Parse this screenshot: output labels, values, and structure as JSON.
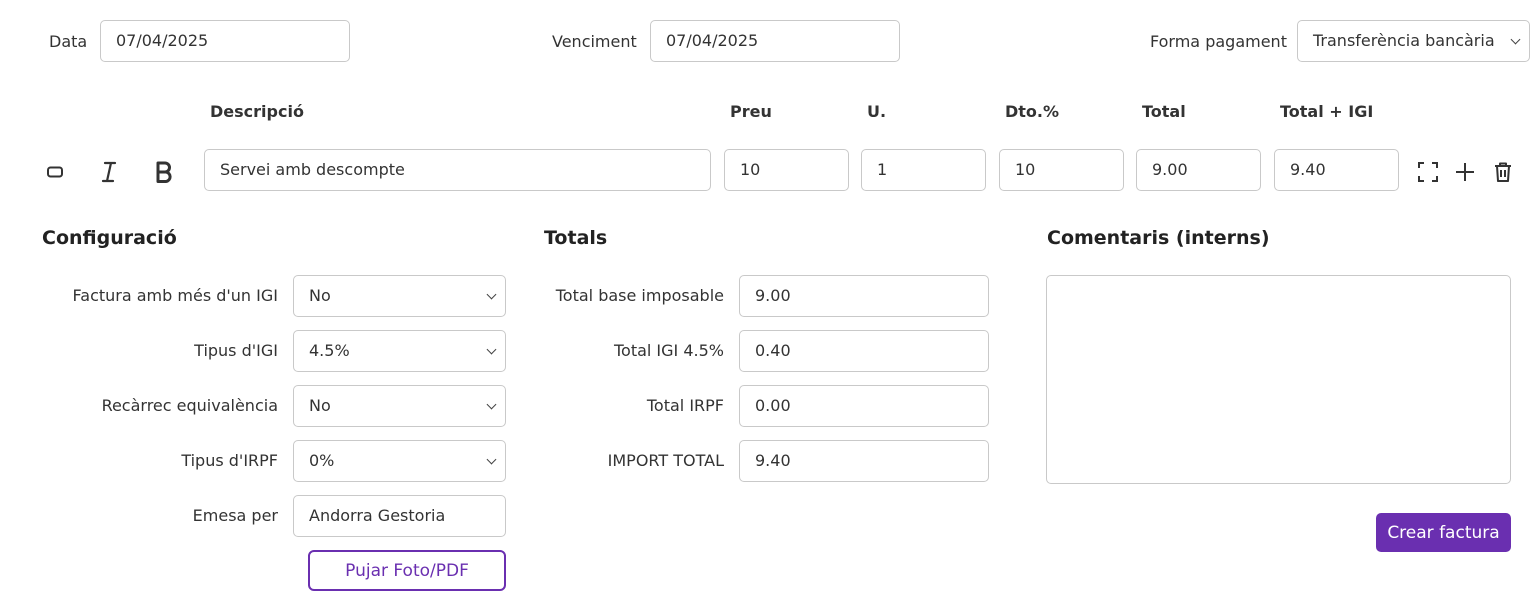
{
  "header": {
    "date_label": "Data",
    "date_value": "07/04/2025",
    "due_label": "Venciment",
    "due_value": "07/04/2025",
    "payment_label": "Forma pagament",
    "payment_value": "Transferència bancària"
  },
  "line_headers": {
    "description": "Descripció",
    "price": "Preu",
    "units": "U.",
    "discount": "Dto.%",
    "total": "Total",
    "total_igi": "Total + IGI"
  },
  "line_item": {
    "description": "Servei amb descompte",
    "price": "10",
    "units": "1",
    "discount": "10",
    "total": "9.00",
    "total_igi": "9.40"
  },
  "toolbar_icons": [
    "rectangle-icon",
    "italic-icon",
    "bold-icon",
    "expand-icon",
    "plus-icon",
    "trash-icon"
  ],
  "configuration": {
    "title": "Configuració",
    "multi_igi_label": "Factura amb més d'un IGI",
    "multi_igi_value": "No",
    "igi_type_label": "Tipus d'IGI",
    "igi_type_value": "4.5%",
    "surcharge_label": "Recàrrec equivalència",
    "surcharge_value": "No",
    "irpf_type_label": "Tipus d'IRPF",
    "irpf_type_value": "0%",
    "issued_by_label": "Emesa per",
    "issued_by_value": "Andorra Gestoria",
    "upload_button": "Pujar Foto/PDF"
  },
  "totals": {
    "title": "Totals",
    "base_label": "Total base imposable",
    "base_value": "9.00",
    "igi_label": "Total IGI 4.5%",
    "igi_value": "0.40",
    "irpf_label": "Total IRPF",
    "irpf_value": "0.00",
    "total_label": "IMPORT TOTAL",
    "total_value": "9.40"
  },
  "comments": {
    "title": "Comentaris (interns)",
    "value": ""
  },
  "actions": {
    "create_button": "Crear factura"
  },
  "colors": {
    "accent": "#6a2fb0",
    "border": "#c9c9c9",
    "text": "#333333"
  }
}
